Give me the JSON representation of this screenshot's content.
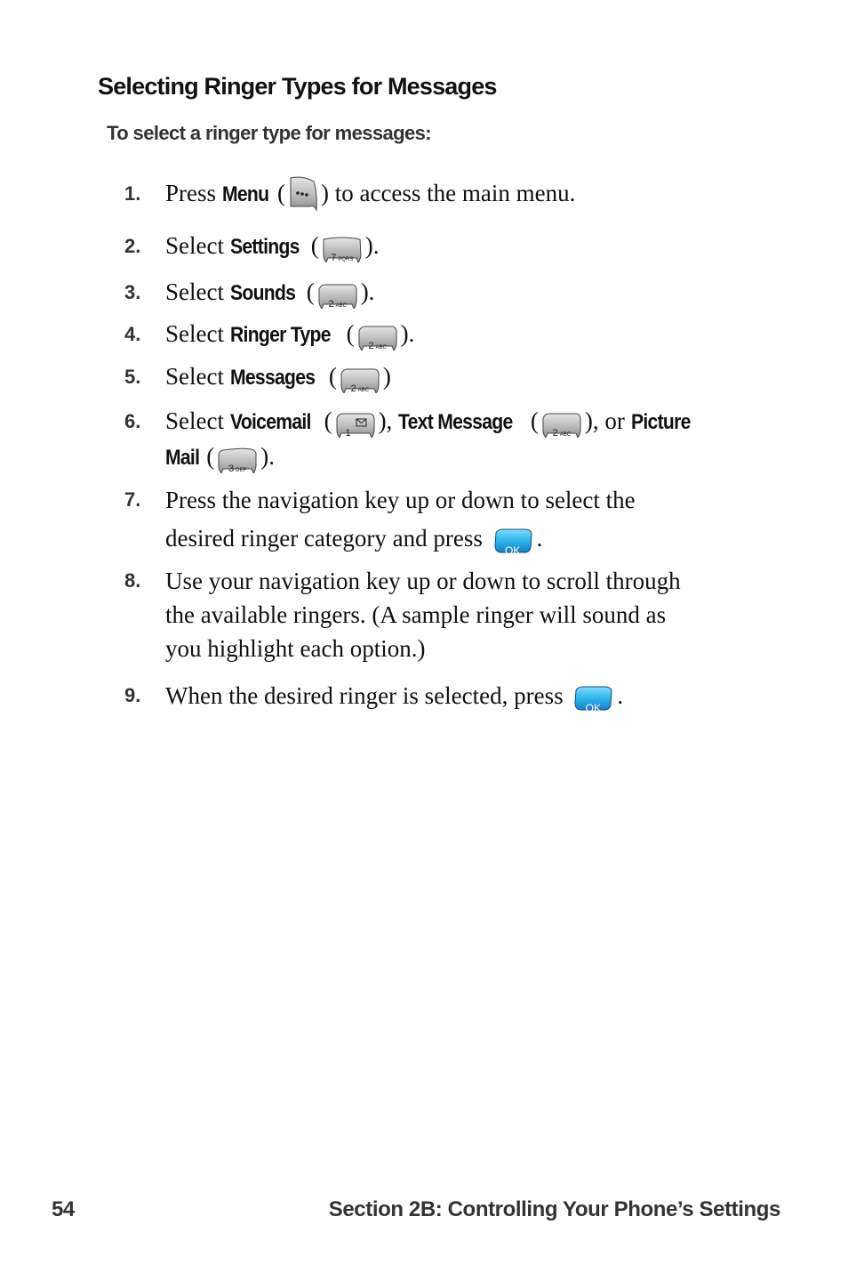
{
  "heading": "Selecting Ringer Types for Messages",
  "subheading": "To select a ringer type for messages:",
  "steps": [
    {
      "num": "1.",
      "pre": "Press ",
      "kw": "Menu",
      "open": " (",
      "key": "menu",
      "post": ") to access the main menu."
    },
    {
      "num": "2.",
      "pre": "Select ",
      "kw": "Settings",
      "open": " (",
      "key_digit": "7",
      "key_letters": "PQRS",
      "post": ")."
    },
    {
      "num": "3.",
      "pre": "Select ",
      "kw": "Sounds",
      "open": " (",
      "key_digit": "2",
      "key_letters": "ABC",
      "post": ")."
    },
    {
      "num": "4.",
      "pre": "Select ",
      "kw": "Ringer Type",
      "open": " (",
      "key_digit": "2",
      "key_letters": "ABC",
      "post": ")."
    },
    {
      "num": "5.",
      "pre": "Select ",
      "kw": "Messages",
      "open": " (",
      "key_digit": "2",
      "key_letters": "ABC",
      "post": ")"
    },
    {
      "num": "6.",
      "pre": "Select ",
      "kw1": "Voicemail",
      "open1": " (",
      "key1_digit": "1",
      "key1_icon": "envelope-icon",
      "close1": "), ",
      "kw2": "Text Message",
      "open2": " (",
      "key2_digit": "2",
      "key2_letters": "ABC",
      "close2": "), or ",
      "kw3a": "Picture",
      "kw3b": "Mail",
      "open3": " (",
      "key3_digit": "3",
      "key3_letters": "DEF",
      "close3": ")."
    },
    {
      "num": "7.",
      "line1": "Press the navigation key up or down to select the",
      "line2": "desired ringer category and press ",
      "ok": "OK",
      "post": "."
    },
    {
      "num": "8.",
      "line1": "Use your navigation key up or down to scroll through",
      "line2": "the available ringers. (A sample ringer will sound as",
      "line3": "you highlight each option.)"
    },
    {
      "num": "9.",
      "line1": "When the desired ringer is selected, press ",
      "ok": "OK",
      "post": "."
    }
  ],
  "footer": {
    "page_number": "54",
    "section_title": "Section 2B: Controlling Your Phone’s Settings"
  },
  "colors": {
    "ok_key": "#2bb6e8",
    "key_gray": "#a9a9a9",
    "text": "#111111",
    "number": "#333333"
  }
}
